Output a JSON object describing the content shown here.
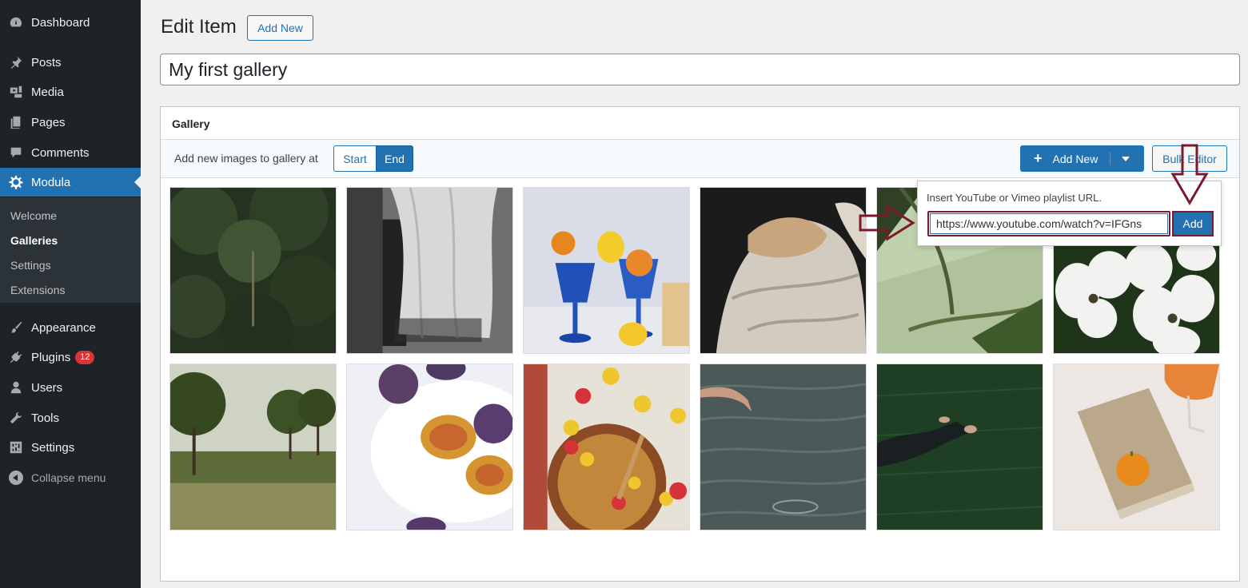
{
  "sidebar": {
    "items": [
      {
        "label": "Dashboard",
        "icon": "dashboard-icon"
      },
      {
        "label": "Posts",
        "icon": "pin-icon"
      },
      {
        "label": "Media",
        "icon": "media-icon"
      },
      {
        "label": "Pages",
        "icon": "pages-icon"
      },
      {
        "label": "Comments",
        "icon": "comment-icon"
      },
      {
        "label": "Modula",
        "icon": "gear-icon"
      },
      {
        "label": "Appearance",
        "icon": "brush-icon"
      },
      {
        "label": "Plugins",
        "icon": "plug-icon",
        "badge": "12"
      },
      {
        "label": "Users",
        "icon": "user-icon"
      },
      {
        "label": "Tools",
        "icon": "wrench-icon"
      },
      {
        "label": "Settings",
        "icon": "sliders-icon"
      }
    ],
    "submenu": [
      "Welcome",
      "Galleries",
      "Settings",
      "Extensions"
    ],
    "collapse_label": "Collapse menu"
  },
  "header": {
    "title": "Edit Item",
    "add_new_label": "Add New"
  },
  "post_title": "My first gallery",
  "gallery": {
    "heading": "Gallery",
    "add_at_label": "Add new images to gallery at",
    "start_label": "Start",
    "end_label": "End",
    "add_new_label": "Add New",
    "bulk_editor_label": "Bulk Editor"
  },
  "popup": {
    "label": "Insert YouTube or Vimeo playlist URL.",
    "url_value": "https://www.youtube.com/watch?v=IFGns",
    "add_label": "Add"
  },
  "colors": {
    "sidebar_bg": "#1d2327",
    "accent": "#2271b1",
    "annotation": "#7b1a2c",
    "badge": "#d63638"
  },
  "images": [
    "forest",
    "curtain-window",
    "citrus-blue-glasses",
    "bed-sheets",
    "palm-leaf-wall",
    "white-flowers",
    "field-trees",
    "plums-plate",
    "fruit-bowl",
    "water-hand",
    "person-in-grass",
    "book-orange"
  ]
}
